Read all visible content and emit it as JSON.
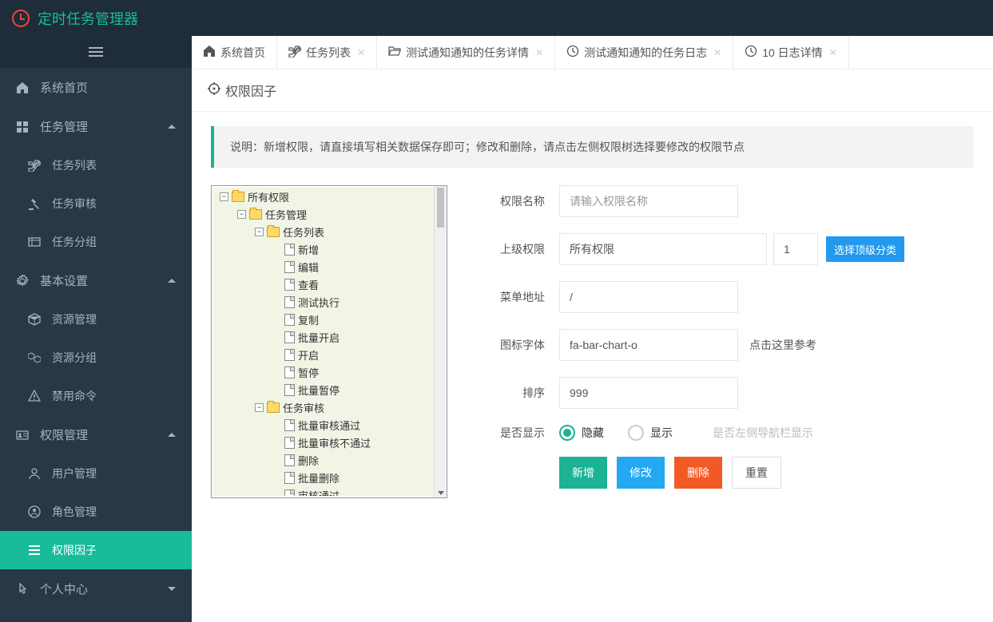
{
  "app_title": "定时任务管理器",
  "sidebar": {
    "items": [
      {
        "label": "系统首页",
        "icon": "home",
        "type": "link"
      },
      {
        "label": "任务管理",
        "icon": "grid",
        "type": "group",
        "expanded": true
      },
      {
        "label": "任务列表",
        "icon": "random",
        "type": "sub"
      },
      {
        "label": "任务审核",
        "icon": "gavel",
        "type": "sub"
      },
      {
        "label": "任务分组",
        "icon": "group",
        "type": "sub"
      },
      {
        "label": "基本设置",
        "icon": "gear",
        "type": "group",
        "expanded": true
      },
      {
        "label": "资源管理",
        "icon": "cube",
        "type": "sub"
      },
      {
        "label": "资源分组",
        "icon": "cubes",
        "type": "sub"
      },
      {
        "label": "禁用命令",
        "icon": "warning",
        "type": "sub"
      },
      {
        "label": "权限管理",
        "icon": "id",
        "type": "group",
        "expanded": true
      },
      {
        "label": "用户管理",
        "icon": "user",
        "type": "sub"
      },
      {
        "label": "角色管理",
        "icon": "usercircle",
        "type": "sub"
      },
      {
        "label": "权限因子",
        "icon": "list",
        "type": "sub",
        "active": true
      },
      {
        "label": "个人中心",
        "icon": "pointer",
        "type": "group",
        "expanded": false
      }
    ]
  },
  "tabs": [
    {
      "label": "系统首页",
      "icon": "home",
      "closable": false
    },
    {
      "label": "任务列表",
      "icon": "random",
      "closable": true
    },
    {
      "label": "测试通知通知的任务详情",
      "icon": "folder-open",
      "closable": true
    },
    {
      "label": "测试通知通知的任务日志",
      "icon": "clock",
      "closable": true
    },
    {
      "label": "10 日志详情",
      "icon": "clock",
      "closable": true
    }
  ],
  "page": {
    "title": "权限因子",
    "alert": "说明：新增权限，请直接填写相关数据保存即可；修改和删除，请点击左侧权限树选择要修改的权限节点",
    "tree": [
      {
        "label": "所有权限",
        "type": "folder",
        "depth": 0,
        "toggle": "-"
      },
      {
        "label": "任务管理",
        "type": "folder",
        "depth": 1,
        "toggle": "-"
      },
      {
        "label": "任务列表",
        "type": "folder",
        "depth": 2,
        "toggle": "-"
      },
      {
        "label": "新增",
        "type": "file",
        "depth": 3
      },
      {
        "label": "编辑",
        "type": "file",
        "depth": 3
      },
      {
        "label": "查看",
        "type": "file",
        "depth": 3
      },
      {
        "label": "测试执行",
        "type": "file",
        "depth": 3
      },
      {
        "label": "复制",
        "type": "file",
        "depth": 3
      },
      {
        "label": "批量开启",
        "type": "file",
        "depth": 3
      },
      {
        "label": "开启",
        "type": "file",
        "depth": 3
      },
      {
        "label": "暂停",
        "type": "file",
        "depth": 3
      },
      {
        "label": "批量暂停",
        "type": "file",
        "depth": 3
      },
      {
        "label": "任务审核",
        "type": "folder",
        "depth": 2,
        "toggle": "-"
      },
      {
        "label": "批量审核通过",
        "type": "file",
        "depth": 3
      },
      {
        "label": "批量审核不通过",
        "type": "file",
        "depth": 3
      },
      {
        "label": "删除",
        "type": "file",
        "depth": 3
      },
      {
        "label": "批量删除",
        "type": "file",
        "depth": 3
      },
      {
        "label": "审核通过",
        "type": "file",
        "depth": 3
      }
    ],
    "form": {
      "name_label": "权限名称",
      "name_placeholder": "请输入权限名称",
      "name_value": "",
      "parent_label": "上级权限",
      "parent_value": "所有权限",
      "parent_id": "1",
      "parent_btn": "选择顶级分类",
      "url_label": "菜单地址",
      "url_value": "/",
      "icon_label": "图标字体",
      "icon_value": "fa-bar-chart-o",
      "icon_ref": "点击这里参考",
      "sort_label": "排序",
      "sort_value": "999",
      "display_label": "是否显示",
      "display_hidden": "隐藏",
      "display_show": "显示",
      "display_hint": "是否左侧导航栏显示",
      "display_value": "hidden",
      "btn_add": "新增",
      "btn_edit": "修改",
      "btn_delete": "删除",
      "btn_reset": "重置"
    }
  }
}
